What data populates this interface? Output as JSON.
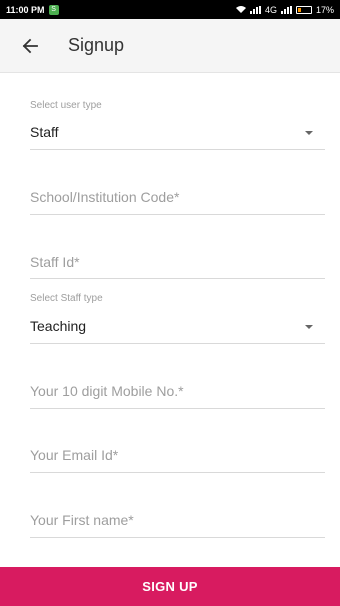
{
  "status_bar": {
    "time": "11:00 PM",
    "network": "4G",
    "battery": "17%"
  },
  "app_bar": {
    "title": "Signup"
  },
  "form": {
    "user_type": {
      "label": "Select user type",
      "value": "Staff"
    },
    "school_code": {
      "placeholder": "School/Institution Code*"
    },
    "staff_id": {
      "placeholder": "Staff Id*"
    },
    "staff_type": {
      "label": "Select Staff type",
      "value": "Teaching"
    },
    "mobile": {
      "placeholder": "Your 10 digit Mobile No.*"
    },
    "email": {
      "placeholder": "Your Email Id*"
    },
    "first_name": {
      "placeholder": "Your First name*"
    }
  },
  "actions": {
    "signup_label": "SIGN UP"
  },
  "colors": {
    "accent": "#d81b60",
    "app_bar": "#f5f5f5",
    "status_bar": "#000000"
  }
}
